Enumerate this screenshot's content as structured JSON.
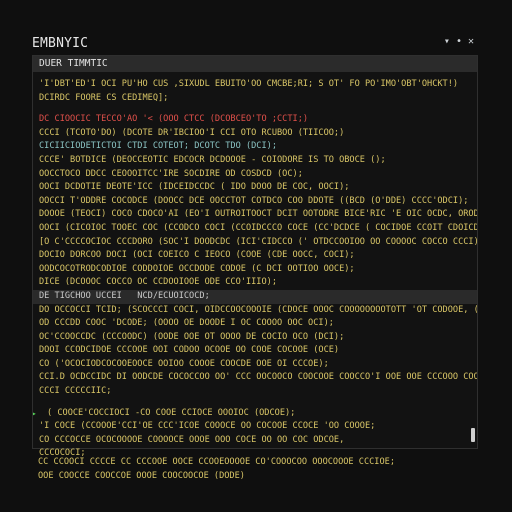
{
  "window": {
    "title": "EMBNYIC",
    "controls": [
      "▾",
      "•",
      "✕"
    ]
  },
  "pane": {
    "header": "DUER TIMMTIC"
  },
  "lines": [
    {
      "text": "'I'DBT'ED'I OCI PU'HO CUS ,SIXUDL EBUITO'OO CMCBE;RI; S OT' FO PO'IMO'OBT'OHCKT!)",
      "color": "#d9c667"
    },
    {
      "text": "DCIRDC FOORE CS CEDIMEQ];",
      "color": "#d9c667"
    },
    {
      "text": "",
      "color": "#000000",
      "blank": true
    },
    {
      "text": "DC CIOOCIC TECCO'AO '< (OOO CTCC (DCOBCEO'TO ;CCTI;)",
      "color": "#e0504a"
    },
    {
      "text": "CCCI (TCOTO'DO) (DCOTE DR'IBCIOO'I CCI OTO RCUBOO (TIICOO;)",
      "color": "#d9c667"
    },
    {
      "text": "CICIICIODETICTOI CTDI COTEOT; DCOTC TDO (DCI);",
      "color": "#8bc4c4"
    },
    {
      "text": "CCCE' BOTDICE (DEOCCEOTIC EDCOCR DCDOOOE - COIODORE IS TO OBOCE ();",
      "color": "#d9c667"
    },
    {
      "text": "OOCCTOCO DDCC CEOOOITCC'IRE SOCDIRE OD COSDCD (OC);",
      "color": "#d9c667"
    },
    {
      "text": "OOCI DCDOTIE DEOTE'ICC (IDCEIDCCDC ( IDO DOOO DE COC, OOCI);",
      "color": "#d9c667"
    },
    {
      "text": "OOCCI T'ODDRE COCODCE (DOOCC DCE OOCCTOT COTDCO COO DDOTE ((BCD (O'DDE) CCCC'ODCI);",
      "color": "#d9c667"
    },
    {
      "text": "DOOOE (TEOCI) COCO CDOCO'AI (EO'I OUTROITOOCT DCIT OOTODRE BICE'RIC 'E OIC OCDC, ORODEI OCO TO DDODORE);",
      "color": "#d9c667"
    },
    {
      "text": "OOCI (CICOIOC TOOEC COC (CCODCO COCI (CCOIDCCCO COCE (CC'DCDCE ( COCIDOE CCOIT CDOICD COOE CCCCO (DCI));",
      "color": "#d9c667"
    },
    {
      "text": "[O C'CCCCOCIOC CCCDORO (SOC'I DOODCDC (ICI'CIDCCO (' OTDCCOOIOO OO COOOOC COCCO CCCI);",
      "color": "#d9c667"
    },
    {
      "text": "DOCIO DORCOO DOCI (OCI COEICO C IEOCO (COOE (CDE OOCC, COCI);",
      "color": "#d9c667"
    },
    {
      "text": "OODCOCOTRODCODIOE CODDOIOE OCCDODE CODOE (C DCI OOTIOO OOCE);",
      "color": "#d9c667"
    },
    {
      "text": "DICE (DCOOOC COCCO OC CCDOOIOOE ODE CCO'IIIO);",
      "color": "#d9c667"
    },
    {
      "text": "DE TIGCHOO UCCEI   NCD/ECUOICOCD;",
      "color": "#c9c9c9",
      "highlight": true
    },
    {
      "text": "DO OCCOCCI TCID; (SCOCCCI COCI, OIDCCOOCOOOIE (CDOCE OOOC COOOOOOOOTOTT 'OT CODOOE, (CCC ) ODOC COI)",
      "color": "#d9c667"
    },
    {
      "text": "OD CCCDD COOC 'DCODE; (OOOO OE DOODE I OC COOOO OOC OCI);",
      "color": "#d9c667"
    },
    {
      "text": "OC'CCOOCCDC (CCCOODC) (OODE OOE OT OOOO DE COCIO OCO (DCI);",
      "color": "#d9c667"
    },
    {
      "text": "DOOI CCODCIDOE CCCOOE OOI CODOO OCOOE OO COOE COCOOE (OCE)",
      "color": "#d9c667"
    },
    {
      "text": "CO ('OCOCIODCOCOOEOOCE OOIOO COOOE COOCDE OOE OI CCCOE);",
      "color": "#d9c667"
    },
    {
      "text": "CCI.D OCDCCIDC DI OODCDE COCOCCOO OO' CCC OOCOOCO COOCOOE COOCCO'I OOE OOE CCCOOO COOCCOE CO COOCOE,",
      "color": "#d9c667"
    },
    {
      "text": "CCCI CCCCCIIC;",
      "color": "#d9c667"
    },
    {
      "text": "",
      "color": "#000000",
      "blank": true
    },
    {
      "text": "( COOCE'COCCIOCI -CO COOE CCIOCE OOOIOC (ODCOE);",
      "color": "#d9c667",
      "arrow": true
    },
    {
      "text": "'I COCE (CCOOOE'CCI'OE CCC'ICOE COOOCE OO COCOOE CCOCE 'OO COOOE;",
      "color": "#d9c667"
    },
    {
      "text": "CO CCCOCCE OCOCOOOOE COOOOCE OOOE OOO COCE OO OO COC ODCOE,",
      "color": "#d9c667"
    },
    {
      "text": "CCCOCOCI;",
      "color": "#d9c667"
    }
  ],
  "footer_lines": [
    {
      "text": "CC CCOOCI CCCCE CC CCCOOE OOCE CCOOEOOOOE CO'COOOCOO OOOCOOOE CCCIOE;",
      "color": "#d9c667"
    },
    {
      "text": "OOE COOCCE COOCCOE OOOE COOCOOCOE (DODE)",
      "color": "#d9c667"
    }
  ]
}
